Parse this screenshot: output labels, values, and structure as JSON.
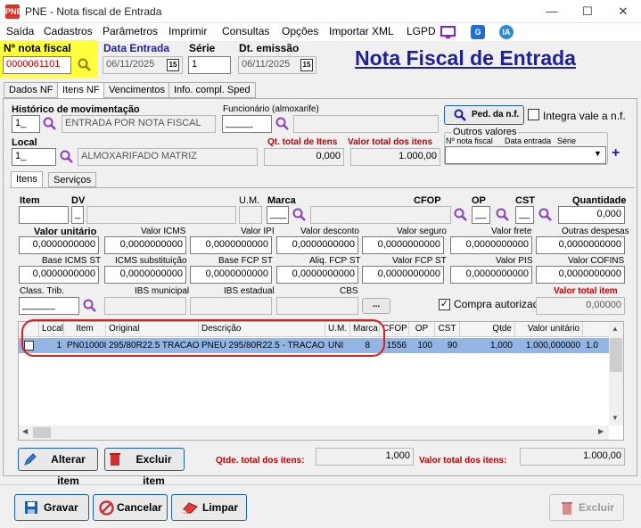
{
  "window": {
    "app_icon": "PNE",
    "title": "PNE - Nota fiscal de Entrada",
    "minimize": "—",
    "maximize": "☐",
    "close": "✕"
  },
  "menu": [
    "Saída",
    "Cadastros",
    "Parâmetros",
    "Imprimir",
    "Consultas",
    "Opções",
    "Importar XML",
    "LGPD"
  ],
  "menu_badges": {
    "g": "G",
    "ia": "IA"
  },
  "header": {
    "nota_label": "Nº nota fiscal",
    "nota_value": "0000061101",
    "data_entrada_label": "Data Entrada",
    "data_entrada_value": "06/11/2025",
    "serie_label": "Série",
    "serie_value": "1",
    "dt_emissao_label": "Dt. emissão",
    "dt_emissao_value": "06/11/2025",
    "cal_label": "15",
    "page_title": "Nota Fiscal de Entrada"
  },
  "tabs": [
    "Dados NF",
    "Itens NF",
    "Vencimentos",
    "Info. compl. Sped"
  ],
  "mov": {
    "historico_label": "Histórico de movimentação",
    "historico_code": "1_",
    "historico_desc": "ENTRADA POR NOTA FISCAL",
    "funcionario_label": "Funcionário (almoxarife)",
    "funcionario_code": "_____",
    "local_label": "Local",
    "local_code": "1_",
    "local_desc": "ALMOXARIFADO MATRIZ",
    "qt_total_label": "Qt. total de Itens",
    "qt_total_value": "0,000",
    "valor_total_label": "Valor total dos itens",
    "valor_total_value": "1.000,00",
    "ped_button": "Ped. da n.f.",
    "integra_label": "Integra vale a n.f.",
    "outros_title": "Outros valores",
    "outros_cols": [
      "Nº nota fiscal",
      "Data entrada",
      "Série"
    ],
    "plus": "+"
  },
  "subtabs": [
    "Itens",
    "Serviços"
  ],
  "item_form": {
    "labels_row1": {
      "item": "Item",
      "dv": "DV",
      "um": "U.M.",
      "marca": "Marca",
      "cfop": "CFOP",
      "op": "OP",
      "cst": "CST",
      "quantidade": "Quantidade"
    },
    "dv_value": "_",
    "marca_value": "___",
    "op_value": "__",
    "cst_value": "__",
    "quantidade_value": "0,000",
    "row2": [
      {
        "label": "Valor unitário",
        "value": "0,0000000000",
        "bold": true
      },
      {
        "label": "Valor ICMS",
        "value": "0,0000000000"
      },
      {
        "label": "Valor IPI",
        "value": "0,0000000000"
      },
      {
        "label": "Valor desconto",
        "value": "0,0000000000"
      },
      {
        "label": "Valor seguro",
        "value": "0,0000000000"
      },
      {
        "label": "Valor frete",
        "value": "0,0000000000"
      },
      {
        "label": "Outras despesas",
        "value": "0,0000000000"
      }
    ],
    "row3": [
      {
        "label": "Base ICMS ST",
        "value": "0,0000000000"
      },
      {
        "label": "ICMS substituição",
        "value": "0,0000000000"
      },
      {
        "label": "Base FCP ST",
        "value": "0,0000000000"
      },
      {
        "label": "Aliq. FCP ST",
        "value": "0,0000000000"
      },
      {
        "label": "Valor FCP ST",
        "value": "0,0000000000"
      },
      {
        "label": "Valor PIS",
        "value": "0,0000000000"
      },
      {
        "label": "Valor COFINS",
        "value": "0,0000000000"
      }
    ],
    "class_trib_label": "Class. Trib.",
    "class_trib_value": "______",
    "ibs_mun_label": "IBS municipal",
    "ibs_est_label": "IBS estadual",
    "cbs_label": "CBS",
    "ellipsis": "...",
    "compra_label": "Compra autorizada",
    "valor_total_item_label": "Valor total item",
    "valor_total_item_value": "0,00000"
  },
  "grid": {
    "columns": [
      "Local",
      "Item",
      "Original",
      "Descrição",
      "U.M.",
      "Marca",
      "CFOP",
      "OP",
      "CST",
      "Qtde",
      "Valor unitário"
    ],
    "row": {
      "local": "1",
      "item": "PN010008",
      "original": "295/80R22.5 TRACAO",
      "descricao": "PNEU 295/80R22.5 - TRACAO ...",
      "um": "UNI",
      "marca": "8",
      "cfop": "1556",
      "op": "100",
      "cst": "90",
      "qtde": "1,000",
      "valor_unitario": "1.000,000000",
      "extra": "1.0"
    }
  },
  "item_buttons": {
    "alterar": "Alterar item",
    "excluir": "Excluir item"
  },
  "totals": {
    "qtde_label": "Qtde. total dos itens:",
    "qtde_value": "1,000",
    "valor_label": "Valor total dos itens:",
    "valor_value": "1.000,00"
  },
  "footer": {
    "gravar": "Gravar",
    "cancelar": "Cancelar",
    "limpar": "Limpar",
    "excluir": "Excluir"
  },
  "colors": {
    "accent": "#1f1f9e",
    "highlight": "#ffff3d",
    "selection": "#93b5e3",
    "red": "#c00000",
    "circle": "#e01b1b"
  }
}
